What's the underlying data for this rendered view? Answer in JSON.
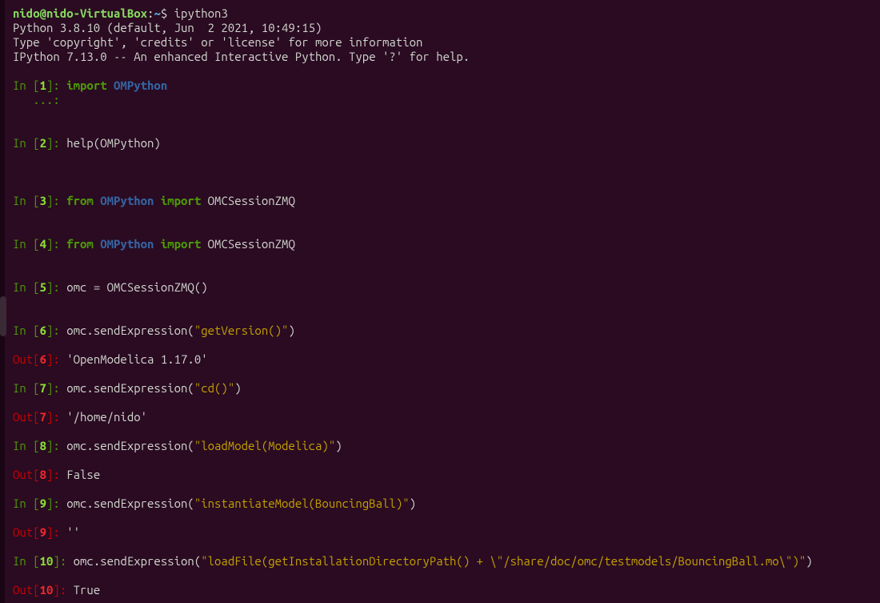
{
  "prompt": {
    "user": "nido",
    "at": "@",
    "host": "nido-VirtualBox",
    "colon": ":",
    "path": "~",
    "dollar": "$ ",
    "command": "ipython3"
  },
  "header": {
    "l1": "Python 3.8.10 (default, Jun  2 2021, 10:49:15)",
    "l2": "Type 'copyright', 'credits' or 'license' for more information",
    "l3": "IPython 7.13.0 -- An enhanced Interactive Python. Type '?' for help."
  },
  "cells": {
    "in1": {
      "pre": "In [",
      "num": "1",
      "post": "]: ",
      "kw": "import",
      "sp": " ",
      "mod": "OMPython"
    },
    "in1cont": "   ...: ",
    "in2": {
      "pre": "In [",
      "num": "2",
      "post": "]: ",
      "code": "help(OMPython)"
    },
    "in3": {
      "pre": "In [",
      "num": "3",
      "post": "]: ",
      "kw1": "from",
      "sp1": " ",
      "mod": "OMPython",
      "sp2": " ",
      "kw2": "import",
      "sp3": " ",
      "tail": "OMCSessionZMQ"
    },
    "in4": {
      "pre": "In [",
      "num": "4",
      "post": "]: ",
      "kw1": "from",
      "sp1": " ",
      "mod": "OMPython",
      "sp2": " ",
      "kw2": "import",
      "sp3": " ",
      "tail": "OMCSessionZMQ"
    },
    "in5": {
      "pre": "In [",
      "num": "5",
      "post": "]: ",
      "code": "omc = OMCSessionZMQ()"
    },
    "in6": {
      "pre": "In [",
      "num": "6",
      "post": "]: ",
      "c1": "omc.sendExpression(",
      "str": "\"getVersion()\"",
      "c2": ")"
    },
    "out6": {
      "pre": "Out[",
      "num": "6",
      "post": "]: ",
      "val": "'OpenModelica 1.17.0'"
    },
    "in7": {
      "pre": "In [",
      "num": "7",
      "post": "]: ",
      "c1": "omc.sendExpression(",
      "str": "\"cd()\"",
      "c2": ")"
    },
    "out7": {
      "pre": "Out[",
      "num": "7",
      "post": "]: ",
      "val": "'/home/nido'"
    },
    "in8": {
      "pre": "In [",
      "num": "8",
      "post": "]: ",
      "c1": "omc.sendExpression(",
      "str": "\"loadModel(Modelica)\"",
      "c2": ")"
    },
    "out8": {
      "pre": "Out[",
      "num": "8",
      "post": "]: ",
      "val": "False"
    },
    "in9": {
      "pre": "In [",
      "num": "9",
      "post": "]: ",
      "c1": "omc.sendExpression(",
      "str": "\"instantiateModel(BouncingBall)\"",
      "c2": ")"
    },
    "out9": {
      "pre": "Out[",
      "num": "9",
      "post": "]: ",
      "val": "''"
    },
    "in10": {
      "pre": "In [",
      "num": "10",
      "post": "]: ",
      "c1": "omc.sendExpression(",
      "str": "\"loadFile(getInstallationDirectoryPath() + \\\"/share/doc/omc/testmodels/BouncingBall.mo\\\")\"",
      "c2": ")"
    },
    "out10": {
      "pre": "Out[",
      "num": "10",
      "post": "]: ",
      "val": "True"
    }
  }
}
